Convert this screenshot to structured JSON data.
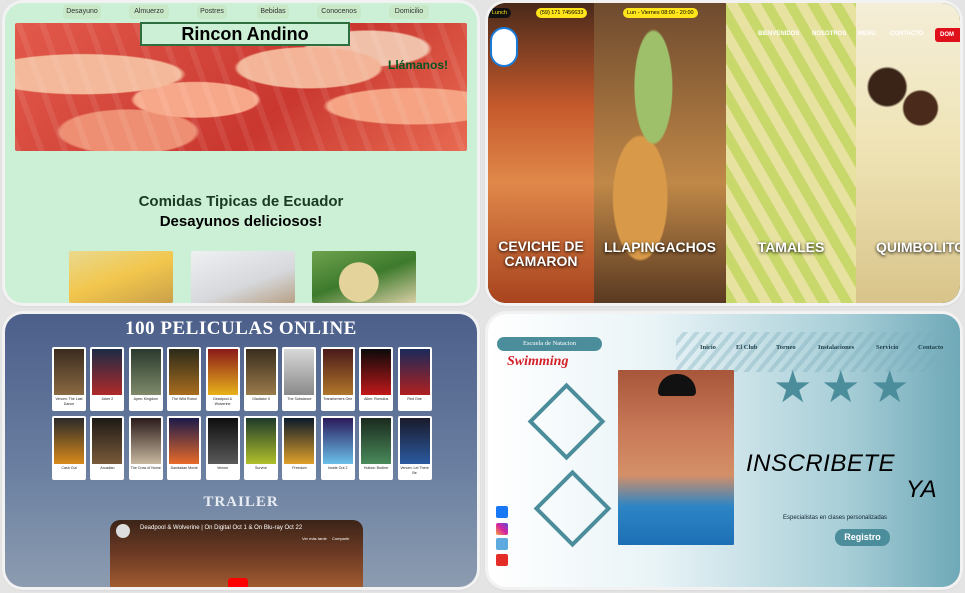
{
  "panel1": {
    "nav": [
      "Desayuno",
      "Almuerzo",
      "Postres",
      "Bebidas",
      "Conocenos",
      "Domicilio"
    ],
    "title": "Rincon Andino",
    "call": "Llámanos!",
    "subtitle": "Comidas Tipicas de Ecuador",
    "subtitle2": "Desayunos deliciosos!"
  },
  "panel2": {
    "top_text": "Lunch",
    "phone": "(59) 171 7456633",
    "hours": "Lun - Viernes 08:00 - 20:00",
    "menu": [
      "BIENVENIDOS",
      "NOSOTROS",
      "MENU",
      "CONTACTO"
    ],
    "dom_button": "DOM",
    "dishes": [
      "CEVICHE DE CAMARON",
      "LLAPINGACHOS",
      "TAMALES",
      "QUIMBOLITO"
    ]
  },
  "panel3": {
    "title": "100 PELICULAS ONLINE",
    "movies": [
      "Venom: The Last Dance",
      "Joker 2",
      "Apes: Kingdom",
      "The Wild Robot",
      "Deadpool & Wolverine",
      "Gladiator II",
      "The Substance",
      "Transformers One",
      "Alien: Romulus",
      "Red One",
      "Cash Out",
      "Arcadian",
      "The Crow of Nome",
      "Dandadan Movie",
      "Venom",
      "Survive",
      "Freedom",
      "Inside Out 2",
      "Hollow: Brother",
      "Venom: Let There Be"
    ],
    "trailer_label": "TRAILER",
    "video_title": "Deadpool & Wolverine | On Digital Oct 1 & On Blu-ray Oct 22",
    "video_actions": [
      "Ver más tarde",
      "Compartir"
    ]
  },
  "panel4": {
    "school_label": "Escuela de Natacion",
    "logo_text": "Swimming",
    "menu": [
      "Inicio",
      "El Club",
      "Torneo",
      "Instalaciones",
      "Servicio",
      "Contacto"
    ],
    "headline1": "INSCRIBETE",
    "headline2": "YA",
    "tagline": "Especialistas en clases personalizadas",
    "register": "Registro"
  },
  "colors": {
    "mint": "#ccf0d5",
    "teal": "#4c8d9c",
    "yellow": "#ffe51a",
    "red": "#e0101a"
  }
}
